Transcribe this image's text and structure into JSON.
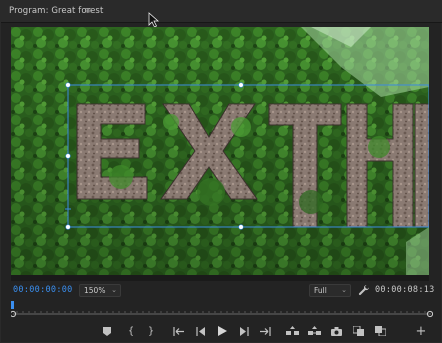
{
  "panel": {
    "title": "Program: Great forest",
    "menu_icon": "≡"
  },
  "viewer": {
    "overlay_text": "EXTH"
  },
  "controls": {
    "timecode_current": "00:00:00:00",
    "zoom_value": "150%",
    "resolution_value": "Full",
    "timecode_duration": "00:00:08:13"
  },
  "icons": {
    "menu": "hamburger-icon",
    "settings": "wrench-icon",
    "add": "plus-icon"
  },
  "colors": {
    "accent": "#3a8ff0",
    "bounding_box": "#3c8be0"
  }
}
